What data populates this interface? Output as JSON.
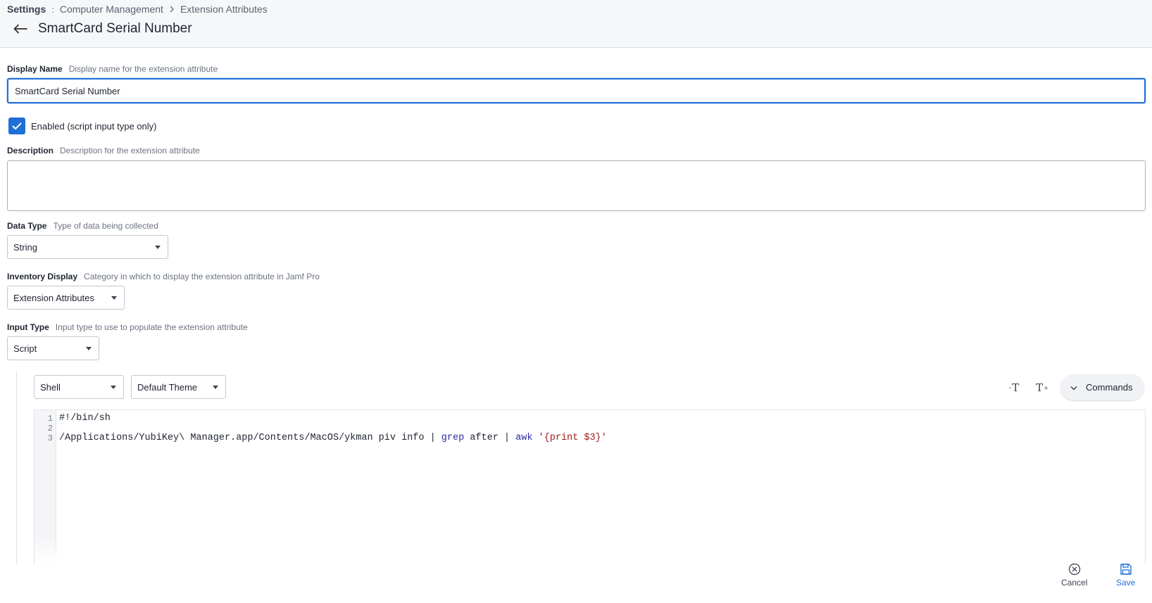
{
  "breadcrumb": {
    "root": "Settings",
    "separator_root": ":",
    "items": [
      "Computer Management",
      "Extension Attributes"
    ]
  },
  "page_title": "SmartCard Serial Number",
  "display_name": {
    "label": "Display Name",
    "hint": "Display name for the extension attribute",
    "value": "SmartCard Serial Number"
  },
  "enabled": {
    "label": "Enabled (script input type only)",
    "checked": true
  },
  "description": {
    "label": "Description",
    "hint": "Description for the extension attribute",
    "value": ""
  },
  "data_type": {
    "label": "Data Type",
    "hint": "Type of data being collected",
    "value": "String"
  },
  "inventory_display": {
    "label": "Inventory Display",
    "hint": "Category in which to display the extension attribute in Jamf Pro",
    "value": "Extension Attributes"
  },
  "input_type": {
    "label": "Input Type",
    "hint": "Input type to use to populate the extension attribute",
    "value": "Script"
  },
  "editor": {
    "language": "Shell",
    "theme": "Default Theme",
    "commands_label": "Commands",
    "line_numbers": [
      "1",
      "2",
      "3"
    ],
    "lines": {
      "l1": "#!/bin/sh",
      "l2": "",
      "l3_a": "/Applications/YubiKey\\ Manager.app/Contents/MacOS/ykman piv info | ",
      "l3_grep": "grep",
      "l3_b": " after | ",
      "l3_awk": "awk",
      "l3_c": " ",
      "l3_str": "'{print $3}'"
    }
  },
  "actions": {
    "cancel": "Cancel",
    "save": "Save"
  },
  "colors": {
    "accent": "#1f6fd6",
    "code_keyword": "#2a2aa0",
    "code_string": "#a11d1d"
  }
}
